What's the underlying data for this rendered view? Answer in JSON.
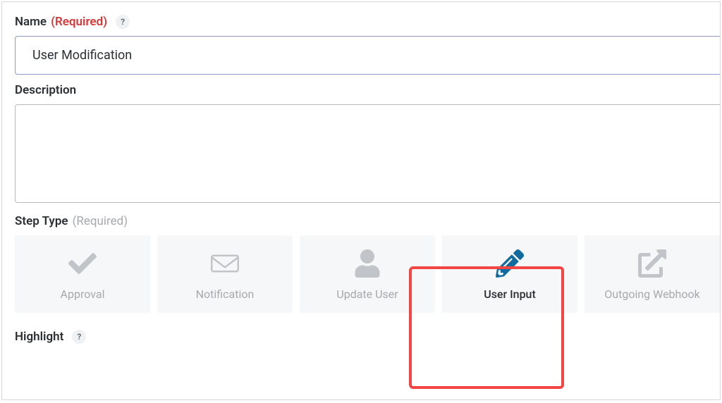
{
  "fields": {
    "name": {
      "label": "Name",
      "required_text": "(Required)",
      "help_symbol": "?",
      "value": "User Modification"
    },
    "description": {
      "label": "Description",
      "value": ""
    },
    "step_type": {
      "label": "Step Type",
      "required_text": "(Required)"
    },
    "highlight": {
      "label": "Highlight",
      "help_symbol": "?"
    }
  },
  "step_types": [
    {
      "label": "Approval",
      "icon": "check-icon",
      "selected": false
    },
    {
      "label": "Notification",
      "icon": "envelope-icon",
      "selected": false
    },
    {
      "label": "Update User",
      "icon": "user-icon",
      "selected": false
    },
    {
      "label": "User Input",
      "icon": "pencil-icon",
      "selected": true
    },
    {
      "label": "Outgoing Webhook",
      "icon": "external-link-icon",
      "selected": false
    }
  ],
  "colors": {
    "required": "#d63939",
    "active_icon": "#126b9e",
    "highlight_border": "#f44545"
  }
}
